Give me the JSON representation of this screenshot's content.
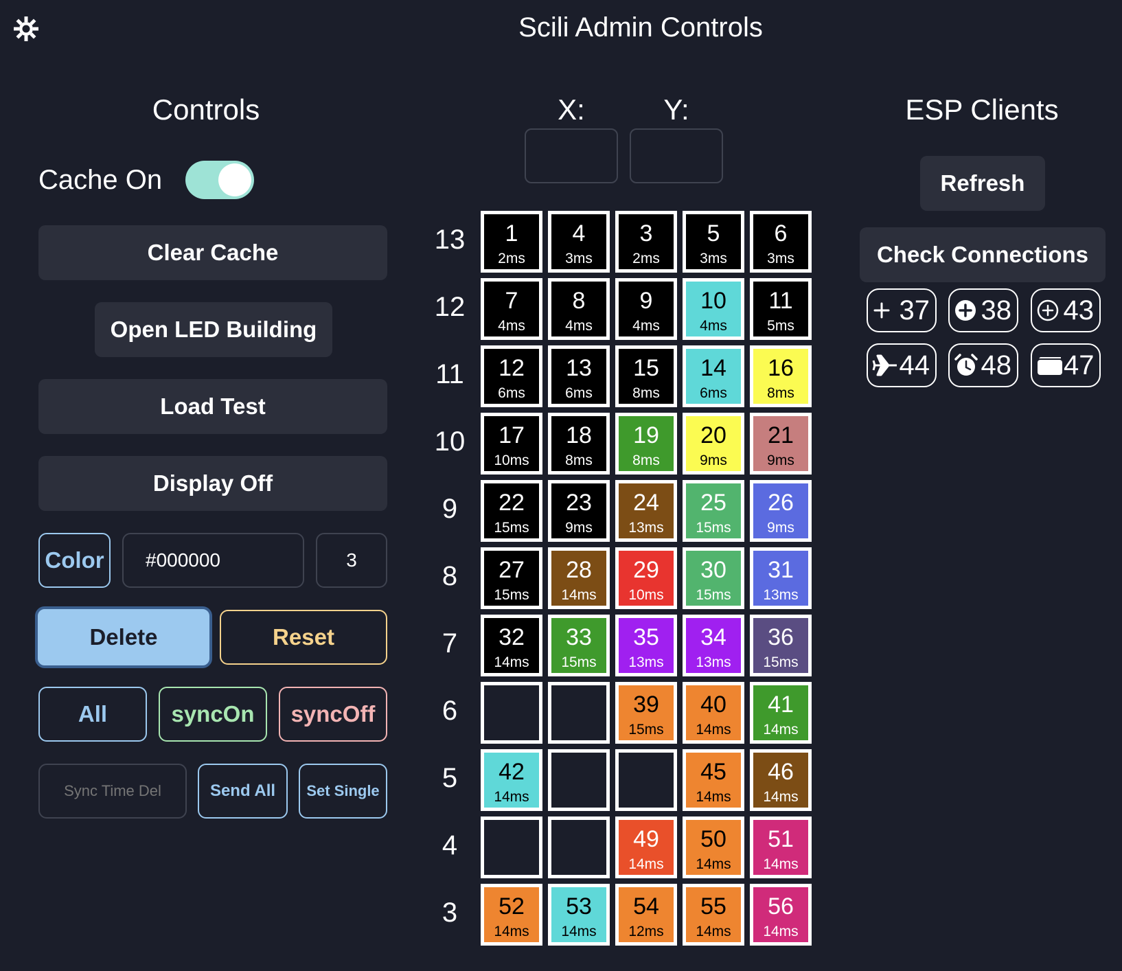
{
  "header": {
    "title": "Scili Admin Controls",
    "settings_icon": "gear-icon"
  },
  "controls": {
    "heading": "Controls",
    "cache_label": "Cache On",
    "cache_on": true,
    "clear_cache": "Clear Cache",
    "open_led": "Open LED Building",
    "load_test": "Load Test",
    "display_off": "Display Off",
    "color_label": "Color",
    "color_value": "#000000",
    "count_value": "3",
    "delete": "Delete",
    "reset": "Reset",
    "all": "All",
    "sync_on": "syncOn",
    "sync_off": "syncOff",
    "sync_time_placeholder": "Sync Time Del",
    "send_all": "Send All",
    "set_single": "Set Single"
  },
  "grid": {
    "x_label": "X:",
    "y_label": "Y:",
    "x_value": "",
    "y_value": "",
    "rows": [
      {
        "label": "13",
        "cells": [
          {
            "num": "1",
            "ms": "2ms",
            "color": "#000000",
            "text": "#ffffff"
          },
          {
            "num": "4",
            "ms": "3ms",
            "color": "#000000",
            "text": "#ffffff"
          },
          {
            "num": "3",
            "ms": "2ms",
            "color": "#000000",
            "text": "#ffffff"
          },
          {
            "num": "5",
            "ms": "3ms",
            "color": "#000000",
            "text": "#ffffff"
          },
          {
            "num": "6",
            "ms": "3ms",
            "color": "#000000",
            "text": "#ffffff"
          }
        ]
      },
      {
        "label": "12",
        "cells": [
          {
            "num": "7",
            "ms": "4ms",
            "color": "#000000",
            "text": "#ffffff"
          },
          {
            "num": "8",
            "ms": "4ms",
            "color": "#000000",
            "text": "#ffffff"
          },
          {
            "num": "9",
            "ms": "4ms",
            "color": "#000000",
            "text": "#ffffff"
          },
          {
            "num": "10",
            "ms": "4ms",
            "color": "#5fd8d8",
            "text": "#000000"
          },
          {
            "num": "11",
            "ms": "5ms",
            "color": "#000000",
            "text": "#ffffff"
          }
        ]
      },
      {
        "label": "11",
        "cells": [
          {
            "num": "12",
            "ms": "6ms",
            "color": "#000000",
            "text": "#ffffff"
          },
          {
            "num": "13",
            "ms": "6ms",
            "color": "#000000",
            "text": "#ffffff"
          },
          {
            "num": "15",
            "ms": "8ms",
            "color": "#000000",
            "text": "#ffffff"
          },
          {
            "num": "14",
            "ms": "6ms",
            "color": "#5fd8d8",
            "text": "#000000"
          },
          {
            "num": "16",
            "ms": "8ms",
            "color": "#fbfb52",
            "text": "#000000"
          }
        ]
      },
      {
        "label": "10",
        "cells": [
          {
            "num": "17",
            "ms": "10ms",
            "color": "#000000",
            "text": "#ffffff"
          },
          {
            "num": "18",
            "ms": "8ms",
            "color": "#000000",
            "text": "#ffffff"
          },
          {
            "num": "19",
            "ms": "8ms",
            "color": "#3f9a2c",
            "text": "#ffffff"
          },
          {
            "num": "20",
            "ms": "9ms",
            "color": "#fbfb52",
            "text": "#000000"
          },
          {
            "num": "21",
            "ms": "9ms",
            "color": "#c67e7e",
            "text": "#000000"
          }
        ]
      },
      {
        "label": "9",
        "cells": [
          {
            "num": "22",
            "ms": "15ms",
            "color": "#000000",
            "text": "#ffffff"
          },
          {
            "num": "23",
            "ms": "9ms",
            "color": "#000000",
            "text": "#ffffff"
          },
          {
            "num": "24",
            "ms": "13ms",
            "color": "#7c4d15",
            "text": "#ffffff"
          },
          {
            "num": "25",
            "ms": "15ms",
            "color": "#52b46e",
            "text": "#ffffff"
          },
          {
            "num": "26",
            "ms": "9ms",
            "color": "#5b6be0",
            "text": "#ffffff"
          }
        ]
      },
      {
        "label": "8",
        "cells": [
          {
            "num": "27",
            "ms": "15ms",
            "color": "#000000",
            "text": "#ffffff"
          },
          {
            "num": "28",
            "ms": "14ms",
            "color": "#7c4d15",
            "text": "#ffffff"
          },
          {
            "num": "29",
            "ms": "10ms",
            "color": "#e8342f",
            "text": "#ffffff"
          },
          {
            "num": "30",
            "ms": "15ms",
            "color": "#52b46e",
            "text": "#ffffff"
          },
          {
            "num": "31",
            "ms": "13ms",
            "color": "#5b6be0",
            "text": "#ffffff"
          }
        ]
      },
      {
        "label": "7",
        "cells": [
          {
            "num": "32",
            "ms": "14ms",
            "color": "#000000",
            "text": "#ffffff"
          },
          {
            "num": "33",
            "ms": "15ms",
            "color": "#3f9a2c",
            "text": "#ffffff"
          },
          {
            "num": "35",
            "ms": "13ms",
            "color": "#a020f0",
            "text": "#ffffff"
          },
          {
            "num": "34",
            "ms": "13ms",
            "color": "#a020f0",
            "text": "#ffffff"
          },
          {
            "num": "36",
            "ms": "15ms",
            "color": "#5a4d82",
            "text": "#ffffff"
          }
        ]
      },
      {
        "label": "6",
        "cells": [
          {
            "num": "",
            "ms": "",
            "color": "#1b1e2a",
            "text": "#ffffff"
          },
          {
            "num": "",
            "ms": "",
            "color": "#1b1e2a",
            "text": "#ffffff"
          },
          {
            "num": "39",
            "ms": "15ms",
            "color": "#ee8530",
            "text": "#000000"
          },
          {
            "num": "40",
            "ms": "14ms",
            "color": "#ee8530",
            "text": "#000000"
          },
          {
            "num": "41",
            "ms": "14ms",
            "color": "#3f9a2c",
            "text": "#ffffff"
          }
        ]
      },
      {
        "label": "5",
        "cells": [
          {
            "num": "42",
            "ms": "14ms",
            "color": "#5fd8d8",
            "text": "#000000"
          },
          {
            "num": "",
            "ms": "",
            "color": "#1b1e2a",
            "text": "#ffffff"
          },
          {
            "num": "",
            "ms": "",
            "color": "#1b1e2a",
            "text": "#ffffff"
          },
          {
            "num": "45",
            "ms": "14ms",
            "color": "#ee8530",
            "text": "#000000"
          },
          {
            "num": "46",
            "ms": "14ms",
            "color": "#7c4d15",
            "text": "#ffffff"
          }
        ]
      },
      {
        "label": "4",
        "cells": [
          {
            "num": "",
            "ms": "",
            "color": "#1b1e2a",
            "text": "#ffffff"
          },
          {
            "num": "",
            "ms": "",
            "color": "#1b1e2a",
            "text": "#ffffff"
          },
          {
            "num": "49",
            "ms": "14ms",
            "color": "#e9502a",
            "text": "#ffffff"
          },
          {
            "num": "50",
            "ms": "14ms",
            "color": "#ee8530",
            "text": "#000000"
          },
          {
            "num": "51",
            "ms": "14ms",
            "color": "#d02b7a",
            "text": "#ffffff"
          }
        ]
      },
      {
        "label": "3",
        "cells": [
          {
            "num": "52",
            "ms": "14ms",
            "color": "#ee8530",
            "text": "#000000"
          },
          {
            "num": "53",
            "ms": "14ms",
            "color": "#5fd8d8",
            "text": "#000000"
          },
          {
            "num": "54",
            "ms": "12ms",
            "color": "#ee8530",
            "text": "#000000"
          },
          {
            "num": "55",
            "ms": "14ms",
            "color": "#ee8530",
            "text": "#000000"
          },
          {
            "num": "56",
            "ms": "14ms",
            "color": "#d02b7a",
            "text": "#ffffff"
          }
        ]
      }
    ]
  },
  "esp": {
    "heading": "ESP Clients",
    "refresh": "Refresh",
    "check": "Check Connections",
    "clients": [
      {
        "icon": "plus-icon",
        "num": "37"
      },
      {
        "icon": "plus-circle-filled-icon",
        "num": "38"
      },
      {
        "icon": "plus-circle-icon",
        "num": "43"
      },
      {
        "icon": "airplane-icon",
        "num": "44"
      },
      {
        "icon": "alarm-clock-icon",
        "num": "48"
      },
      {
        "icon": "folder-icon",
        "num": "47"
      }
    ]
  }
}
